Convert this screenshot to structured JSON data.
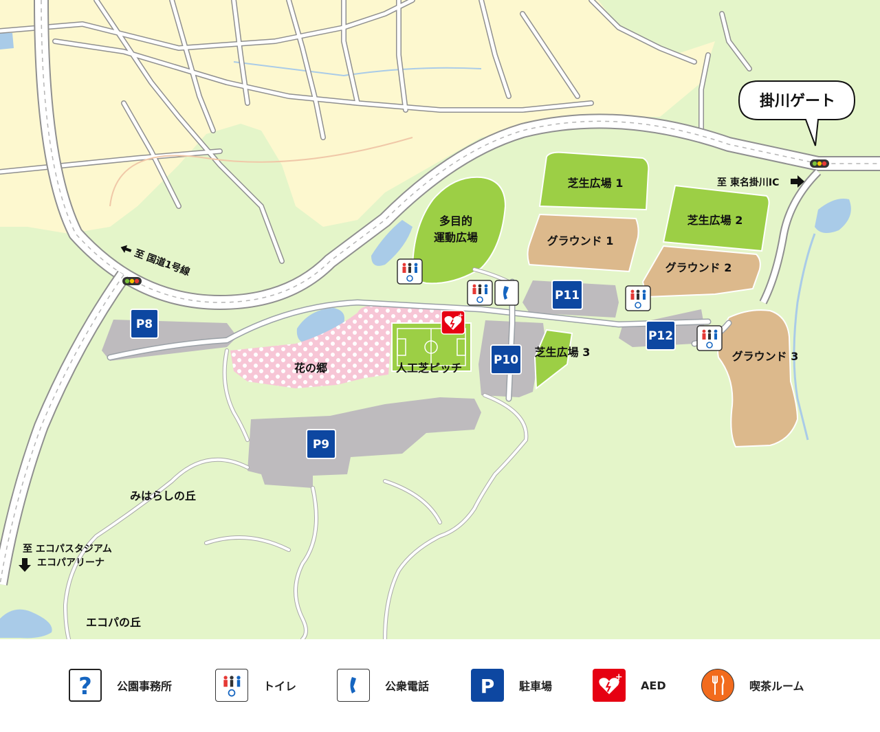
{
  "map": {
    "gate_label": "掛川ゲート",
    "dir_ic": "至 東名掛川IC",
    "dir_route1": "至 国道1号線",
    "dir_eco_line1": "至 エコパスタジアム",
    "dir_eco_line2": "エコパアリーナ",
    "areas": {
      "shibafu1": "芝生広場 1",
      "shibafu2": "芝生広場 2",
      "shibafu3": "芝生広場 3",
      "ground1": "グラウンド 1",
      "ground2": "グラウンド 2",
      "ground3": "グラウンド 3",
      "tamokuteki_1": "多目的",
      "tamokuteki_2": "運動広場",
      "hananosato": "花の郷",
      "jinkoshiba": "人工芝ピッチ",
      "miharashi": "みはらしの丘",
      "ecopa_oka": "エコパの丘"
    },
    "parking": {
      "p8": "P8",
      "p9": "P9",
      "p10": "P10",
      "p11": "P11",
      "p12": "P12"
    }
  },
  "legend": [
    {
      "icon": "question-icon",
      "label": "公園事務所"
    },
    {
      "icon": "toilet-icon",
      "label": "トイレ"
    },
    {
      "icon": "phone-icon",
      "label": "公衆電話"
    },
    {
      "icon": "parking-icon",
      "label": "駐車場"
    },
    {
      "icon": "aed-icon",
      "label": "AED"
    },
    {
      "icon": "cafe-icon",
      "label": "喫茶ルーム"
    }
  ],
  "colors": {
    "urban": "#fdf8cf",
    "park_green": "#e4f5c9",
    "lawn": "#9ccf45",
    "ground": "#dcb98c",
    "parking": "#bebbbe",
    "flower": "#f7c6d6",
    "water": "#a9cbe8",
    "parking_sign": "#0d47a1",
    "aed": "#e60012",
    "cafe": "#f26b1d"
  }
}
